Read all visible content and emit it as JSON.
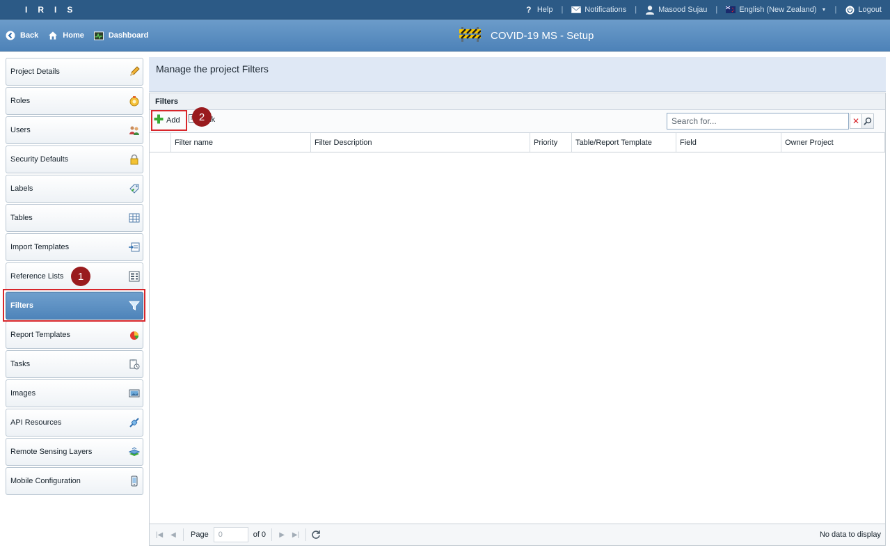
{
  "topbar": {
    "brand": "IRIS",
    "help": "Help",
    "notifications": "Notifications",
    "user": "Masood Sujau",
    "language": "English (New Zealand)",
    "logout": "Logout"
  },
  "nav": {
    "back": "Back",
    "home": "Home",
    "dashboard": "Dashboard",
    "title": "COVID-19 MS - Setup"
  },
  "sidebar": {
    "items": [
      {
        "label": "Project Details",
        "icon": "pencil-icon"
      },
      {
        "label": "Roles",
        "icon": "badge-icon"
      },
      {
        "label": "Users",
        "icon": "users-icon"
      },
      {
        "label": "Security Defaults",
        "icon": "lock-icon"
      },
      {
        "label": "Labels",
        "icon": "label-icon"
      },
      {
        "label": "Tables",
        "icon": "table-icon"
      },
      {
        "label": "Import Templates",
        "icon": "import-icon"
      },
      {
        "label": "Reference Lists",
        "icon": "list-icon"
      },
      {
        "label": "Filters",
        "icon": "funnel-icon",
        "active": true
      },
      {
        "label": "Report Templates",
        "icon": "chart-icon"
      },
      {
        "label": "Tasks",
        "icon": "tasks-icon"
      },
      {
        "label": "Images",
        "icon": "image-icon"
      },
      {
        "label": "API Resources",
        "icon": "api-icon"
      },
      {
        "label": "Remote Sensing Layers",
        "icon": "layers-icon"
      },
      {
        "label": "Mobile Configuration",
        "icon": "mobile-icon"
      }
    ]
  },
  "main": {
    "header": "Manage the project Filters",
    "panel_title": "Filters",
    "add_label": "Add",
    "link_label": "Link",
    "search_placeholder": "Search for...",
    "columns": [
      "Filter name",
      "Filter Description",
      "Priority",
      "Table/Report Template",
      "Field",
      "Owner Project"
    ]
  },
  "pager": {
    "page_label": "Page",
    "page_value": "0",
    "of_label": "of 0",
    "status": "No data to display"
  },
  "annotations": {
    "step1": "1",
    "step2": "2"
  },
  "colors": {
    "topbar": "#2c5a86",
    "navbar": "#5a8ec2",
    "highlight": "#d8262b",
    "badge": "#991b1e",
    "header_bg": "#dfe8f5"
  }
}
